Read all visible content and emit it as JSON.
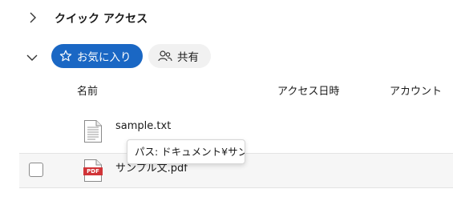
{
  "quick_access": {
    "title": "クイック アクセス"
  },
  "filters": {
    "favorites_label": "お気に入り",
    "shared_label": "共有"
  },
  "columns": {
    "name": "名前",
    "accessed": "アクセス日時",
    "account": "アカウント"
  },
  "files": [
    {
      "name": "sample.txt",
      "icon": "text-file-icon"
    },
    {
      "name": "サンプル文.pdf",
      "icon": "pdf-file-icon",
      "icon_label": "PDF"
    }
  ],
  "tooltip": {
    "text": "パス: ドキュメント¥サンプル"
  },
  "colors": {
    "accent": "#1a67c4",
    "pdf_red": "#d13438",
    "hover_row": "#f6f6f6"
  }
}
